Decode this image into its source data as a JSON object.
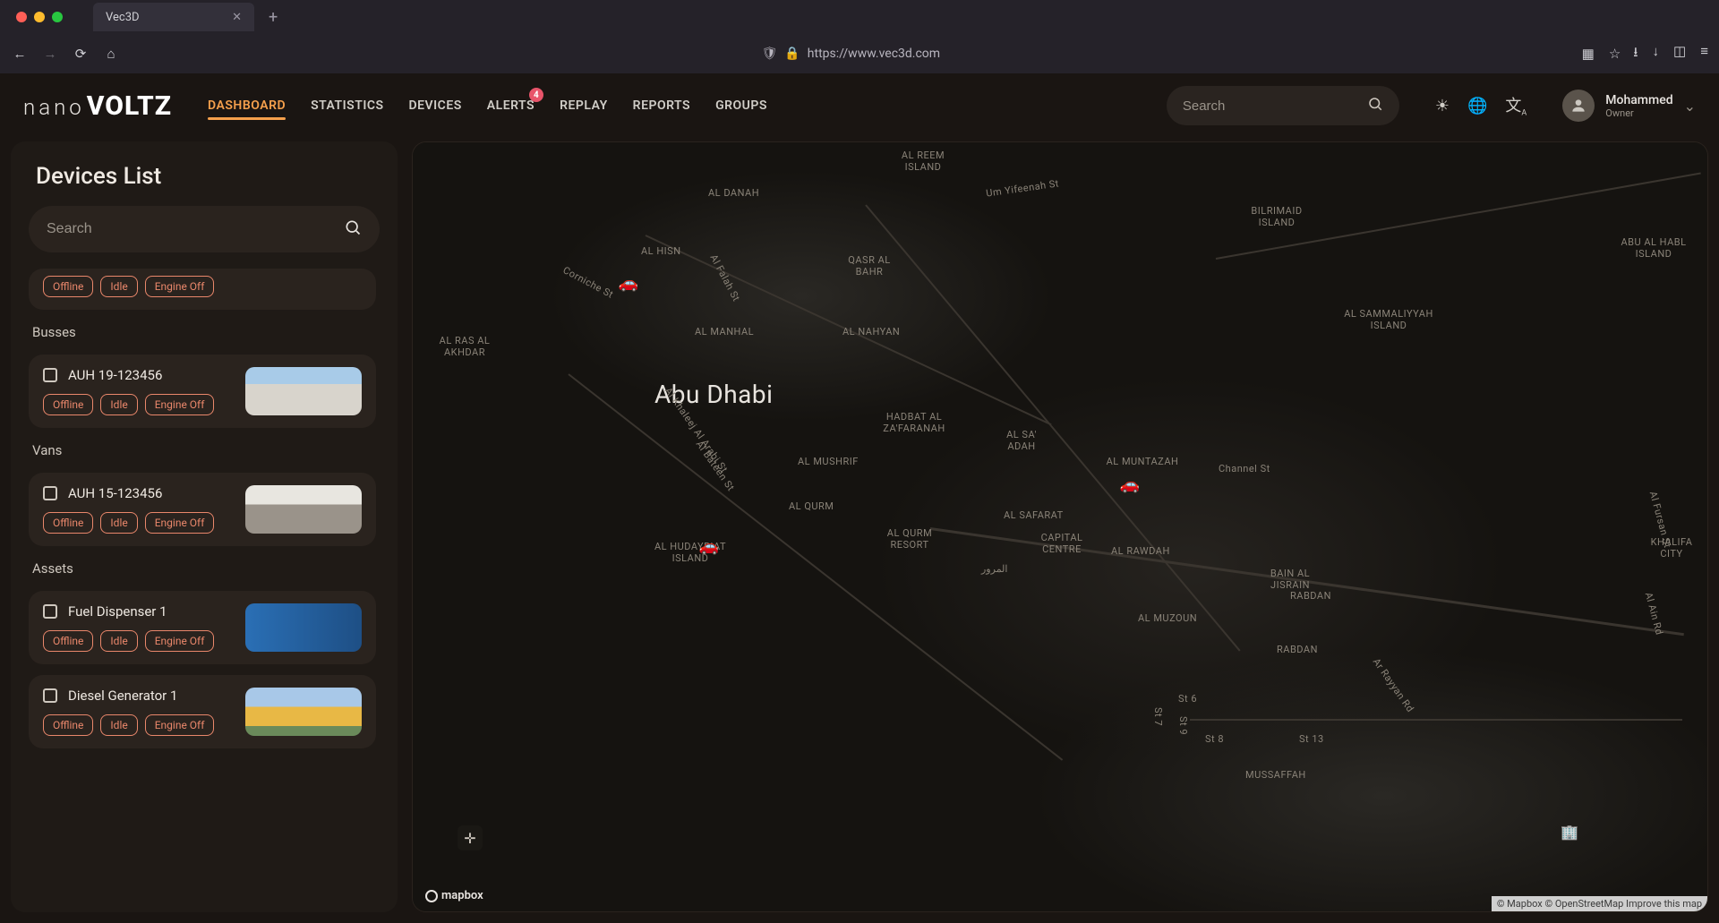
{
  "browser": {
    "tab_title": "Vec3D",
    "url": "https://www.vec3d.com"
  },
  "brand": {
    "part1": "nano",
    "part2": "VOLTZ"
  },
  "nav": {
    "items": [
      {
        "label": "DASHBOARD",
        "active": true
      },
      {
        "label": "STATISTICS"
      },
      {
        "label": "DEVICES"
      },
      {
        "label": "ALERTS",
        "badge": "4"
      },
      {
        "label": "REPLAY"
      },
      {
        "label": "REPORTS"
      },
      {
        "label": "GROUPS"
      }
    ],
    "search_placeholder": "Search"
  },
  "user": {
    "name": "Mohammed",
    "role": "Owner"
  },
  "sidebar": {
    "title": "Devices List",
    "search_placeholder": "Search",
    "tag_offline": "Offline",
    "tag_idle": "Idle",
    "tag_engine_off": "Engine Off",
    "groups": [
      {
        "label": "Busses"
      },
      {
        "label": "Vans"
      },
      {
        "label": "Assets"
      }
    ],
    "devices": {
      "bus1": "AUH 19-123456",
      "van1": "AUH 15-123456",
      "asset1": "Fuel Dispenser 1",
      "asset2": "Diesel Generator 1"
    }
  },
  "map": {
    "city": "Abu Dhabi",
    "logo": "mapbox",
    "attribution": "© Mapbox © OpenStreetMap Improve this map",
    "labels": {
      "al_reem": "AL REEM ISLAND",
      "al_danah": "AL DANAH",
      "bilrimaid": "BILRIMAID ISLAND",
      "abu_al_habl": "ABU AL HABL ISLAND",
      "al_hisn": "AL HISN",
      "qasr": "QASR AL BAHR",
      "corniche": "Corniche St",
      "al_falah": "Al Falah St",
      "yifeenah": "Um Yifeenah St",
      "al_manhal": "AL MANHAL",
      "al_nahyan": "AL NAHYAN",
      "sammaliyyah": "AL SAMMALIYYAH ISLAND",
      "ras_akhdar": "AL RAS AL AKHDAR",
      "khaleej": "Al Khaleej Al Arabi St",
      "bateen": "Al Bateen St",
      "hadbat": "HADBAT AL ZA'FARANAH",
      "al_saadah": "AL SA' ADAH",
      "al_mushrif": "AL MUSHRIF",
      "al_muntazah": "AL MUNTAZAH",
      "channel": "Channel St",
      "al_qurm": "AL QURM",
      "al_safarat": "AL SAFARAT",
      "qurm_resort": "AL QURM RESORT",
      "capital": "CAPITAL CENTRE",
      "hudayriat": "AL HUDAYRIAT ISLAND",
      "rawdah": "AL RAWDAH",
      "bain_jisrain": "BAIN AL JISRAIN",
      "rabdan": "RABDAN",
      "rabdan2": "RABDAN",
      "muzoun": "AL MUZOUN",
      "khalifa": "KHALIFA CITY",
      "ain": "Al Ain Rd",
      "fursan": "Al Fursan St",
      "arrayyan": "Ar Rayyan Rd",
      "mussaffah": "MUSSAFFAH",
      "st6": "St 6",
      "st8": "St 8",
      "st13": "St 13",
      "st7": "St 7",
      "st9": "St 9",
      "arabic": "المرور"
    }
  }
}
